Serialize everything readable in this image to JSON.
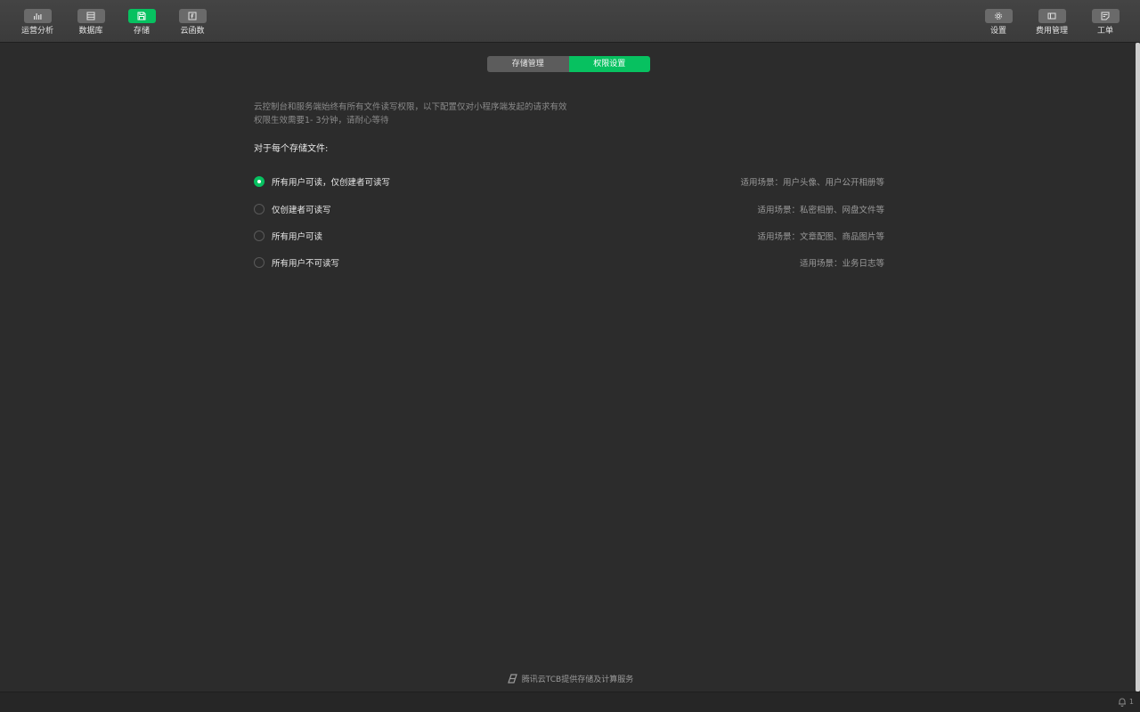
{
  "toolbar": {
    "left": [
      {
        "label": "运营分析",
        "icon": "bar-chart-icon"
      },
      {
        "label": "数据库",
        "icon": "database-icon"
      },
      {
        "label": "存储",
        "icon": "save-icon",
        "active": true
      },
      {
        "label": "云函数",
        "icon": "function-icon"
      }
    ],
    "right": [
      {
        "label": "设置",
        "icon": "gear-icon"
      },
      {
        "label": "费用管理",
        "icon": "wallet-icon"
      },
      {
        "label": "工单",
        "icon": "ticket-icon"
      }
    ]
  },
  "tabs": [
    {
      "label": "存储管理",
      "active": false
    },
    {
      "label": "权限设置",
      "active": true
    }
  ],
  "description": {
    "line1": "云控制台和服务端始终有所有文件读写权限，以下配置仅对小程序端发起的请求有效",
    "line2": "权限生效需要1- 3分钟，请耐心等待"
  },
  "section_title": "对于每个存储文件:",
  "options": [
    {
      "label": "所有用户可读，仅创建者可读写",
      "hint": "适用场景：用户头像、用户公开相册等",
      "checked": true
    },
    {
      "label": "仅创建者可读写",
      "hint": "适用场景：私密相册、网盘文件等",
      "checked": false
    },
    {
      "label": "所有用户可读",
      "hint": "适用场景：文章配图、商品图片等",
      "checked": false
    },
    {
      "label": "所有用户不可读写",
      "hint": "适用场景：业务日志等",
      "checked": false
    }
  ],
  "footer": {
    "text": "腾讯云TCB提供存储及计算服务",
    "icon": "tencent-cloud-icon"
  },
  "status": {
    "notification_count": "1",
    "icon": "bell-icon"
  },
  "colors": {
    "accent": "#07c160",
    "background": "#2c2c2c",
    "toolbar": "#3f3f3f"
  }
}
